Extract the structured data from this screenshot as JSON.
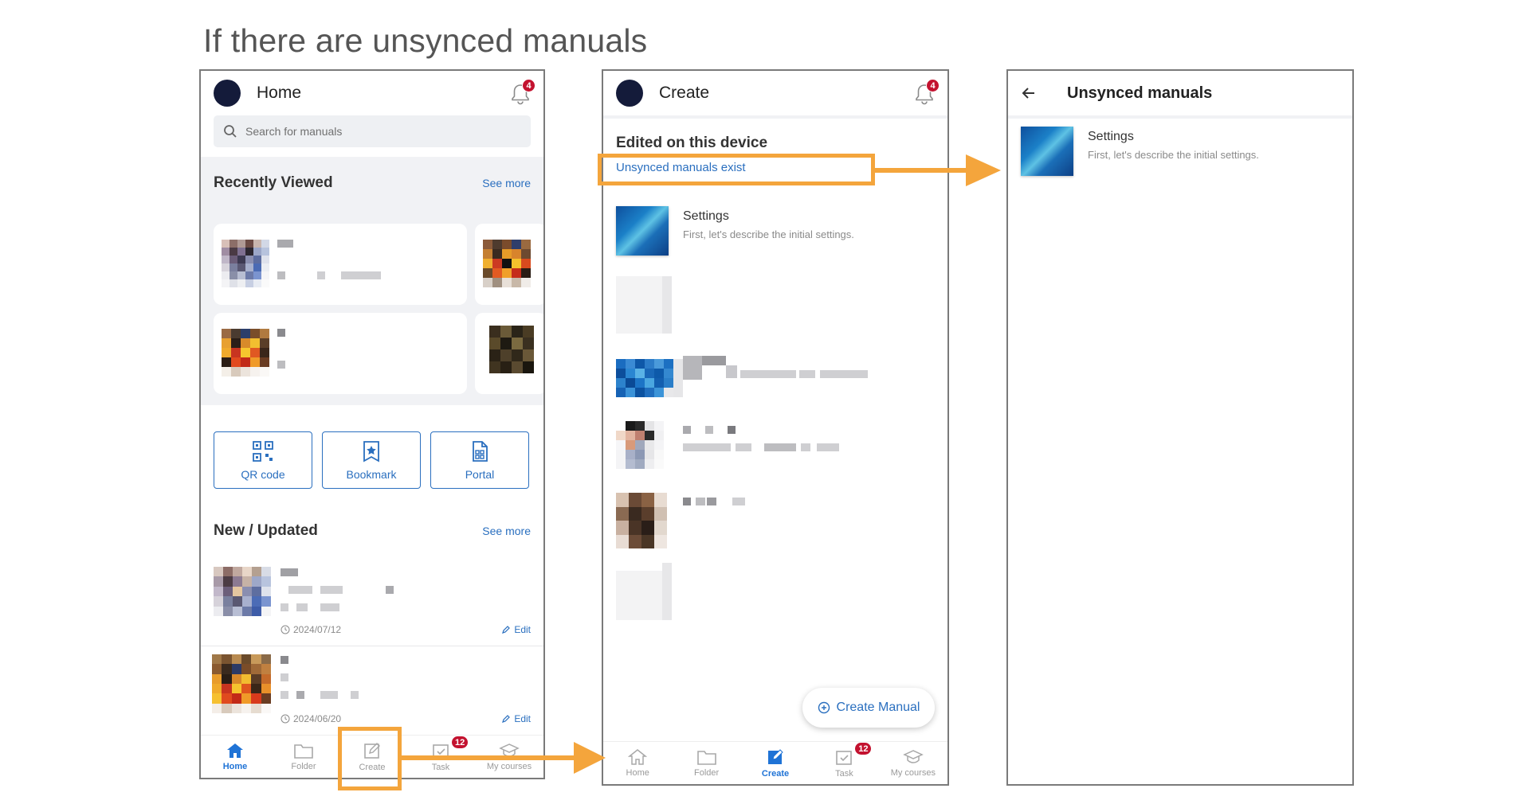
{
  "slide": {
    "title": "If there are unsynced manuals"
  },
  "colors": {
    "accent": "#2a6fbf",
    "highlight": "#f4a53c",
    "badge": "#c3122f",
    "avatar": "#141b3a"
  },
  "home": {
    "title": "Home",
    "notif_count": "4",
    "search_placeholder": "Search for manuals",
    "recent_title": "Recently Viewed",
    "see_more": "See more",
    "shortcuts": [
      {
        "label": "QR code",
        "icon": "qr-code-icon"
      },
      {
        "label": "Bookmark",
        "icon": "bookmark-icon"
      },
      {
        "label": "Portal",
        "icon": "portal-icon"
      }
    ],
    "new_title": "New / Updated",
    "items": [
      {
        "date": "2024/07/12",
        "edit": "Edit"
      },
      {
        "date": "2024/06/20",
        "edit": "Edit"
      }
    ]
  },
  "create": {
    "title": "Create",
    "notif_count": "4",
    "section_title": "Edited on this device",
    "unsynced_link": "Unsynced manuals exist",
    "item_title": "Settings",
    "item_desc": "First, let's describe the initial settings.",
    "fab_label": "Create Manual"
  },
  "unsynced": {
    "title": "Unsynced manuals",
    "item_title": "Settings",
    "item_desc": "First, let's describe the initial settings."
  },
  "nav": {
    "home": "Home",
    "folder": "Folder",
    "create": "Create",
    "task": "Task",
    "courses": "My courses",
    "task_count": "12"
  }
}
